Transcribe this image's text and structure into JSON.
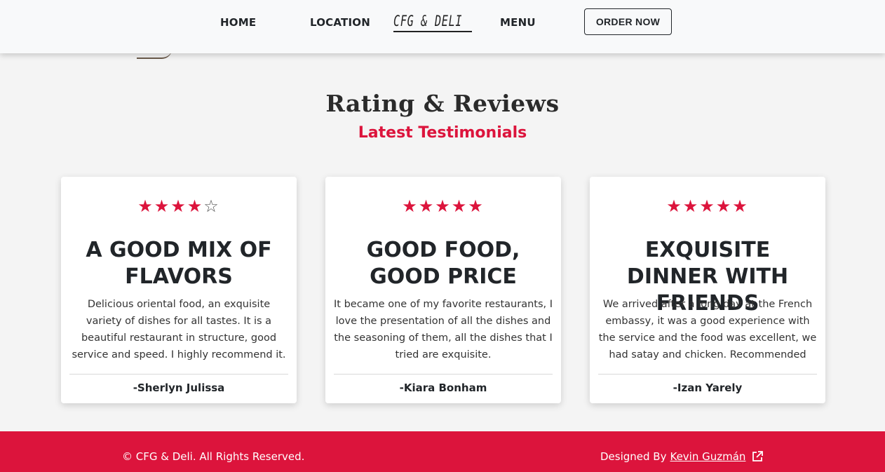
{
  "nav": {
    "home": "HOME",
    "location": "LOCATION",
    "brand": "CFG & DELI",
    "menu": "MENU",
    "order": "ORDER NOW"
  },
  "section": {
    "title": "Rating & Reviews",
    "subtitle": "Latest Testimonials"
  },
  "colors": {
    "accent": "#dc143c",
    "navbar": "#f8f9fa",
    "page": "#f4f4f4"
  },
  "reviews": [
    {
      "rating": 4,
      "max_rating": 5,
      "title": "A GOOD MIX OF FLAVORS",
      "text": "Delicious oriental food, an exquisite variety of dishes for all tastes. It is a beautiful restaurant in structure, good service and speed. I highly recommend it.",
      "author": "-Sherlyn Julissa"
    },
    {
      "rating": 5,
      "max_rating": 5,
      "title": "GOOD FOOD, GOOD PRICE",
      "text": "It became one of my favorite restaurants, I love the presentation of all the dishes and the seasoning of them, all the dishes that I tried are exquisite.",
      "author": "-Kiara Bonham"
    },
    {
      "rating": 5,
      "max_rating": 5,
      "title": "EXQUISITE DINNER WITH FRIENDS",
      "text": "We arrived after a long day at the French embassy, it was a good experience with the service and the food was excellent, we had satay and chicken. Recommended",
      "author": "-Izan Yarely"
    }
  ],
  "footer": {
    "copyright": "© CFG & Deli. All Rights Reserved.",
    "designed_by": "Designed By",
    "designer": "Kevin Guzmán",
    "link_icon": "external-link-icon"
  }
}
